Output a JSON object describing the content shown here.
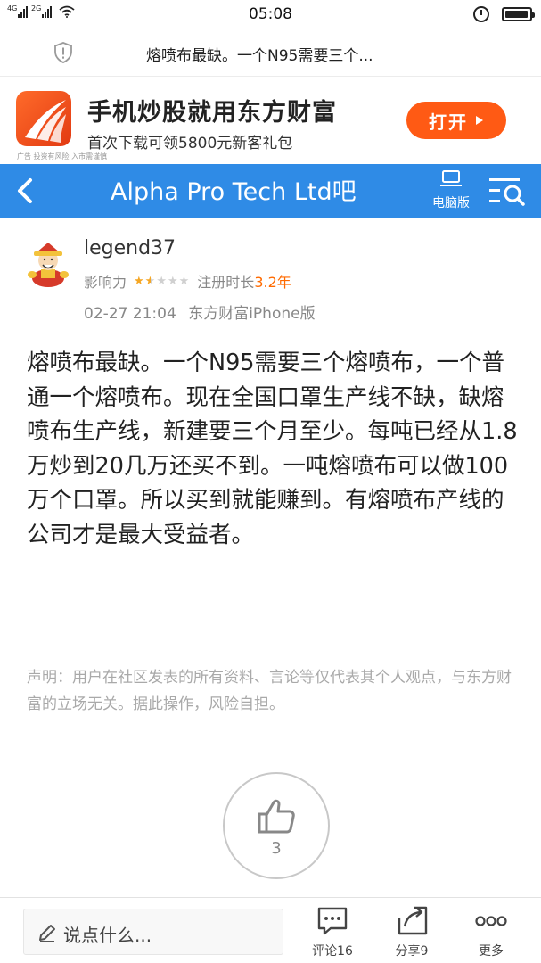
{
  "status_bar": {
    "time": "05:08",
    "network_left": "4G",
    "network_right": "2G",
    "battery_level_pct": 95
  },
  "url_bar": {
    "title": "熔喷布最缺。一个N95需要三个...",
    "icon": "shield-icon"
  },
  "ad": {
    "title": "手机炒股就用东方财富",
    "subtitle": "首次下载可领5800元新客礼包",
    "note": "广告 投资有风险 入市需谨慎",
    "button_label": "打开",
    "logo_color": "#ff5a14"
  },
  "nav": {
    "title": "Alpha Pro Tech Ltd吧",
    "pc_label": "电脑版",
    "bg_color": "#2f8be6"
  },
  "post": {
    "author": "legend37",
    "influence_label": "影响力",
    "influence_stars": 1.5,
    "influence_max": 5,
    "reg_label": "注册时长",
    "reg_value": "3.2年",
    "date": "02-27 21:04",
    "source": "东方财富iPhone版",
    "content": "熔喷布最缺。一个N95需要三个熔喷布，一个普通一个熔喷布。现在全国口罩生产线不缺，缺熔喷布生产线，新建要三个月至少。每吨已经从1.8万炒到20几万还买不到。一吨熔喷布可以做100万个口罩。所以买到就能赚到。有熔喷布产线的公司才是最大受益者。",
    "disclaimer": "声明：用户在社区发表的所有资料、言论等仅代表其个人观点，与东方财富的立场无关。据此操作，风险自担。",
    "like_count": "3"
  },
  "bottom_bar": {
    "reply_placeholder": "说点什么...",
    "comment_label": "评论16",
    "share_label": "分享9",
    "more_label": "更多"
  }
}
